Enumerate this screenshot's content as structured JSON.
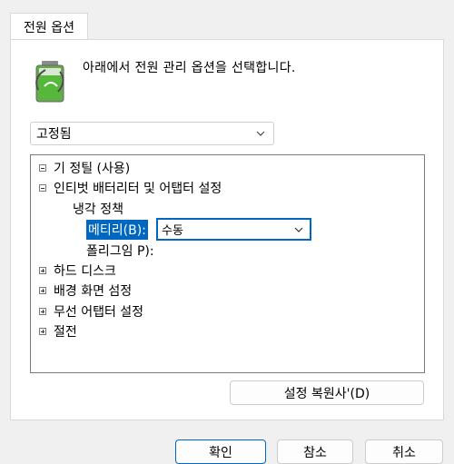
{
  "tab": {
    "label": "전원 옵션"
  },
  "intro": {
    "text": "아래에서 전원 관리 옵션을 선택합니다."
  },
  "plan_select": {
    "value": "고정됨"
  },
  "tree": {
    "n1": "기 정틸 (사용)",
    "n2": "인티벗 배터리터 및 어탭터 설정",
    "n3": "냉각 정책",
    "n4_label": "메티리(B):",
    "n4_value": "수동",
    "n5": "폴리그임 P):",
    "n6": "하드 디스크",
    "n7": "배경 화면 섬정",
    "n8": "무선 어탭터 설정",
    "n9": "절전"
  },
  "buttons": {
    "restore": "설정  복원사'(D)",
    "ok": "확인",
    "cancel": "참소",
    "apply": "취소"
  },
  "colors": {
    "accent": "#0067c0",
    "battery_green": "#55b83b"
  }
}
